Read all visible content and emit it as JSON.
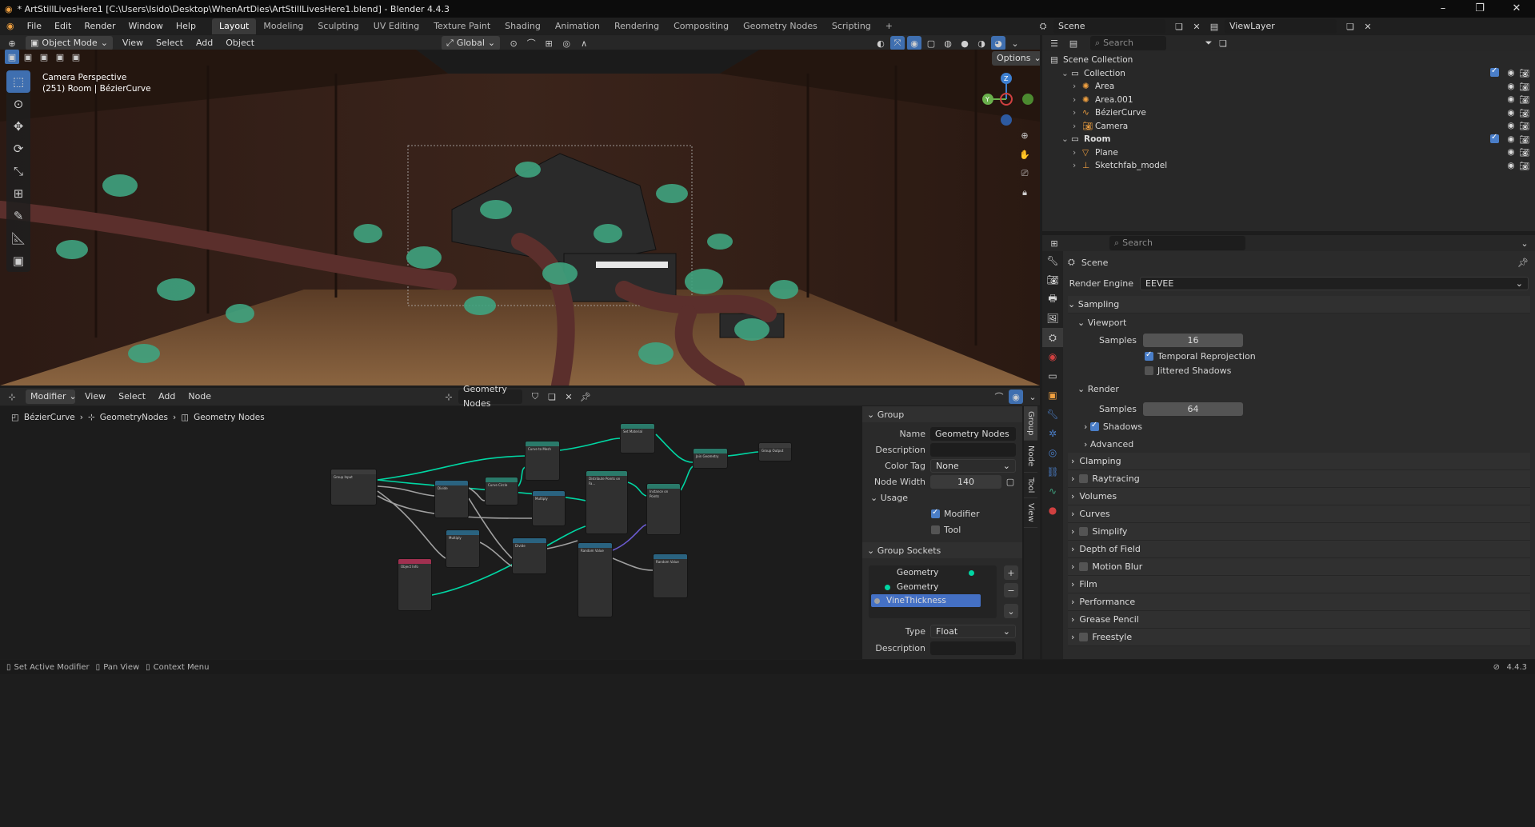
{
  "window": {
    "title": "* ArtStillLivesHere1 [C:\\Users\\Isido\\Desktop\\WhenArtDies\\ArtStillLivesHere1.blend] - Blender 4.4.3"
  },
  "menu": [
    "File",
    "Edit",
    "Render",
    "Window",
    "Help"
  ],
  "workspaces": [
    "Layout",
    "Modeling",
    "Sculpting",
    "UV Editing",
    "Texture Paint",
    "Shading",
    "Animation",
    "Rendering",
    "Compositing",
    "Geometry Nodes",
    "Scripting"
  ],
  "active_workspace": "Layout",
  "scene_selector": "Scene",
  "viewlayer_selector": "ViewLayer",
  "viewport": {
    "mode": "Object Mode",
    "menus": [
      "View",
      "Select",
      "Add",
      "Object"
    ],
    "transform_orientation": "Global",
    "options_label": "Options",
    "overlay_title": "Camera Perspective",
    "overlay_subtitle": "(251) Room | BézierCurve",
    "gizmo": {
      "x": "",
      "y": "Y",
      "z": "Z"
    }
  },
  "node_editor": {
    "editor_type": "Modifier",
    "menus": [
      "View",
      "Select",
      "Add",
      "Node"
    ],
    "tree_name": "Geometry Nodes",
    "breadcrumb": [
      "BézierCurve",
      "GeometryNodes",
      "Geometry Nodes"
    ]
  },
  "npanel": {
    "tabs": [
      "Group",
      "Node",
      "Tool",
      "View"
    ],
    "group_header": "Group",
    "name_label": "Name",
    "name_value": "Geometry Nodes",
    "description_label": "Description",
    "description_value": "",
    "color_tag_label": "Color Tag",
    "color_tag_value": "None",
    "node_width_label": "Node Width",
    "node_width_value": "140",
    "usage_header": "Usage",
    "usage_modifier": "Modifier",
    "usage_tool": "Tool",
    "sockets_header": "Group Sockets",
    "sockets": [
      "Geometry",
      "Geometry",
      "VineThickness"
    ],
    "type_label": "Type",
    "type_value": "Float",
    "desc2_label": "Description"
  },
  "outliner": {
    "search_placeholder": "Search",
    "items": [
      {
        "name": "Scene Collection",
        "depth": 0
      },
      {
        "name": "Collection",
        "depth": 1
      },
      {
        "name": "Area",
        "depth": 2
      },
      {
        "name": "Area.001",
        "depth": 2
      },
      {
        "name": "BézierCurve",
        "depth": 2
      },
      {
        "name": "Camera",
        "depth": 2
      },
      {
        "name": "Room",
        "depth": 1
      },
      {
        "name": "Plane",
        "depth": 2
      },
      {
        "name": "Sketchfab_model",
        "depth": 2
      }
    ]
  },
  "properties": {
    "search_placeholder": "Search",
    "context": "Scene",
    "render_engine_label": "Render Engine",
    "render_engine_value": "EEVEE",
    "sampling": "Sampling",
    "viewport": "Viewport",
    "samples_label": "Samples",
    "viewport_samples": "16",
    "temporal_reprojection": "Temporal Reprojection",
    "jittered_shadows": "Jittered Shadows",
    "render": "Render",
    "render_samples": "64",
    "shadows": "Shadows",
    "advanced": "Advanced",
    "sections": [
      "Clamping",
      "Raytracing",
      "Volumes",
      "Curves",
      "Simplify",
      "Depth of Field",
      "Motion Blur",
      "Film",
      "Performance",
      "Grease Pencil",
      "Freestyle"
    ]
  },
  "status": {
    "left": "Set Active Modifier",
    "middle": "Pan View",
    "right": "Context Menu",
    "version": "4.4.3"
  },
  "nodes": {
    "group_input": "Group Input",
    "group_output": "Group Output",
    "curve_to_mesh": "Curve to Mesh",
    "set_material": "Set Material",
    "curve_circle": "Curve Circle",
    "divide": "Divide",
    "multiply": "Multiply",
    "distribute": "Distribute Points on Fa...",
    "instance_on_points": "Instance on Points",
    "join_geometry": "Join Geometry",
    "object_info": "Object Info",
    "random_value": "Random Value",
    "random_value2": "Random Value"
  }
}
